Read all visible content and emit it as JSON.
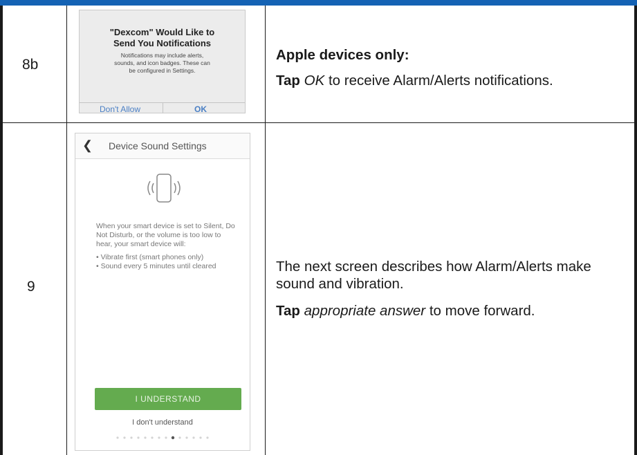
{
  "rows": [
    {
      "step": "8b",
      "dialog": {
        "title_line1": "\"Dexcom\" Would Like to",
        "title_line2": "Send You Notifications",
        "body_line1": "Notifications may include alerts,",
        "body_line2": "sounds, and icon badges. These can",
        "body_line3": "be configured in Settings.",
        "deny_label": "Don't Allow",
        "ok_label": "OK"
      },
      "heading": "Apple devices only:",
      "instruction_verb": "Tap",
      "instruction_target": "OK",
      "instruction_rest": " to receive Alarm/Alerts notifications."
    },
    {
      "step": "9",
      "phone": {
        "title": "Device Sound Settings",
        "para1": "When your smart device is set to Silent, Do Not Disturb, or the volume is too low to hear, your smart device will:",
        "bullet1": "• Vibrate first (smart phones only)",
        "bullet2": "• Sound every 5 minutes until cleared",
        "primary_button": "I UNDERSTAND",
        "secondary_button": "I don't understand"
      },
      "description_line1": "The next screen describes how Alarm/Alerts make",
      "description_line2": "sound and vibration.",
      "instruction_verb": "Tap",
      "instruction_target": "appropriate answer",
      "instruction_rest": " to move forward."
    }
  ],
  "colors": {
    "header_bar": "#1462b4",
    "ok_button": "#64ab4f",
    "dialog_link": "#4a7fc4"
  }
}
